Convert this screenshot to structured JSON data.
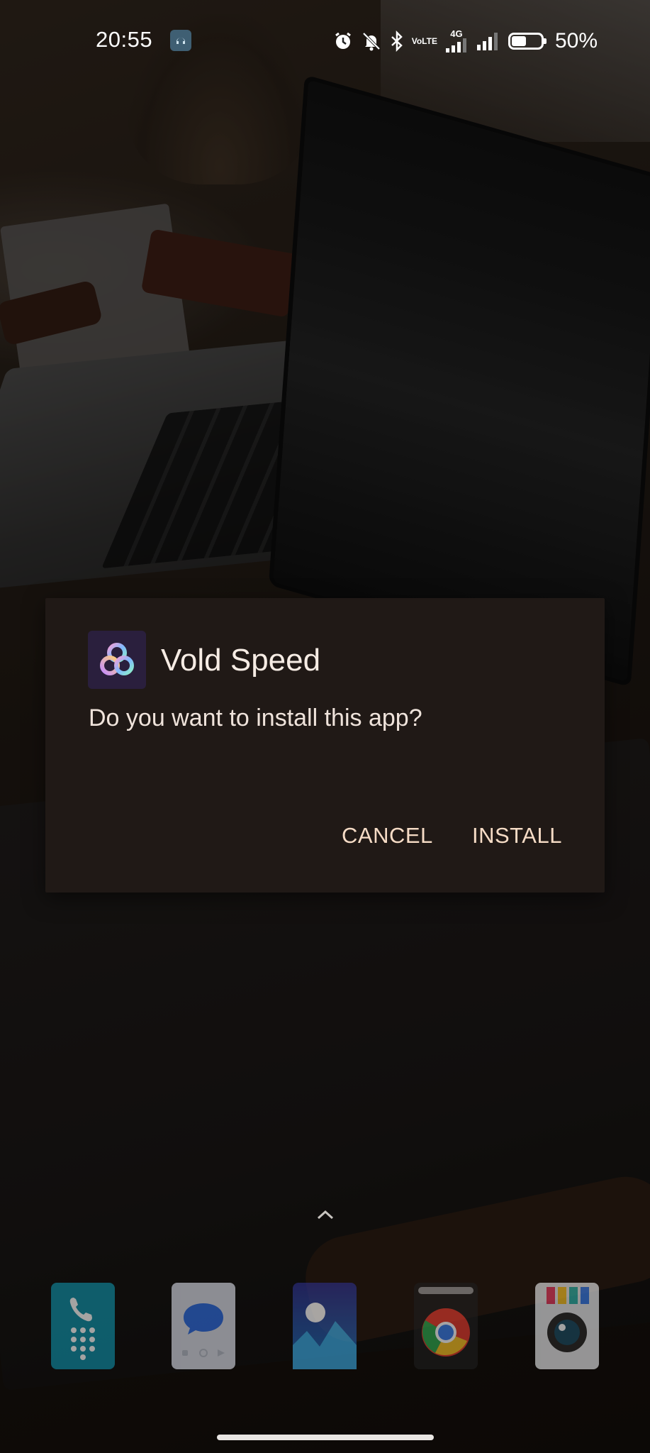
{
  "status_bar": {
    "time": "20:55",
    "volte_line1": "Vo",
    "volte_line2": "LTE",
    "network_type": "4G",
    "battery_percent_text": "50%",
    "battery_level": 0.5,
    "icons": [
      "notification-app-icon",
      "alarm-icon",
      "mute-icon",
      "bluetooth-icon",
      "volte-icon",
      "signal-icon",
      "signal-icon-2",
      "battery-icon"
    ]
  },
  "dialog": {
    "app_name": "Vold Speed",
    "message": "Do you want to install this app?",
    "cancel_label": "CANCEL",
    "install_label": "INSTALL"
  },
  "dock": {
    "apps": [
      "phone",
      "messages",
      "gallery",
      "chrome",
      "camera"
    ]
  },
  "colors": {
    "dialog_bg": "#201916",
    "button_text": "#f6dcc6",
    "title_text": "#f6ece4"
  }
}
